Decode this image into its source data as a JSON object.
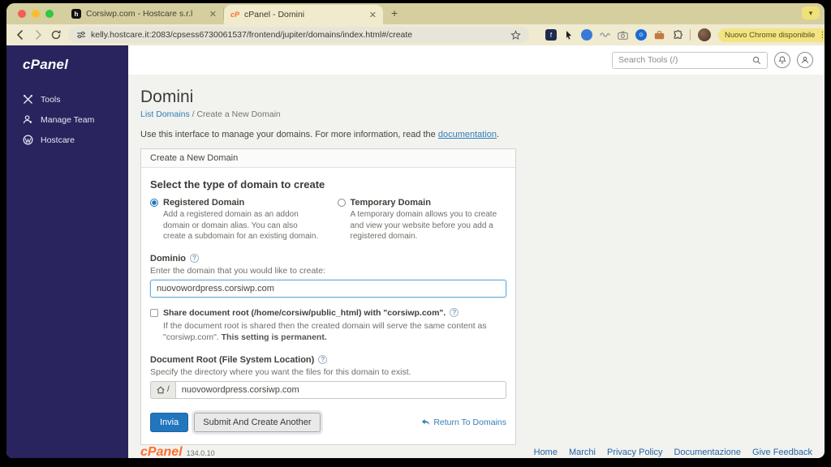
{
  "browser": {
    "tabs": [
      {
        "title": "Corsiwp.com - Hostcare s.r.l",
        "favicon": "h"
      },
      {
        "title": "cPanel - Domini",
        "favicon": "cP"
      }
    ],
    "new_tab": "+",
    "url": "kelly.hostcare.it:2083/cpsess6730061537/frontend/jupiter/domains/index.html#/create",
    "update_button": "Nuovo Chrome disponibile",
    "theme_colors": {
      "tabstrip": "#d5ce9f",
      "toolbar": "#f0ead0",
      "update_pill": "#f2e483"
    }
  },
  "sidebar": {
    "logo": "cPanel",
    "items": [
      {
        "label": "Tools"
      },
      {
        "label": "Manage Team"
      },
      {
        "label": "Hostcare"
      }
    ],
    "bg_color": "#29245e"
  },
  "header": {
    "search_placeholder": "Search Tools (/)"
  },
  "main": {
    "title": "Domini",
    "breadcrumb": {
      "link": "List Domains",
      "separator": "/",
      "current": "Create a New Domain"
    },
    "intro_text": "Use this interface to manage your domains. For more information, read the ",
    "intro_link": "documentation",
    "intro_end": ".",
    "panel": {
      "header": "Create a New Domain",
      "section_title": "Select the type of domain to create",
      "radios": [
        {
          "label": "Registered Domain",
          "desc": "Add a registered domain as an addon domain or domain alias. You can also create a subdomain for an existing domain.",
          "selected": true
        },
        {
          "label": "Temporary Domain",
          "desc": "A temporary domain allows you to create and view your website before you add a registered domain.",
          "selected": false
        }
      ],
      "domain_field": {
        "label": "Dominio",
        "help_text": "Enter the domain that you would like to create:",
        "value": "nuovowordpress.corsiwp.com"
      },
      "share_checkbox": {
        "label": "Share document root (/home/corsiw/public_html) with \"corsiwp.com\".",
        "desc": "If the document root is shared then the created domain will serve the same content as \"corsiwp.com\". ",
        "desc_bold": "This setting is permanent."
      },
      "docroot_field": {
        "label": "Document Root (File System Location)",
        "help_text": "Specify the directory where you want the files for this domain to exist.",
        "prefix": "/",
        "value": "nuovowordpress.corsiwp.com"
      },
      "submit_label": "Invia",
      "submit_another_label": "Submit And Create Another",
      "return_link": "Return To Domains",
      "accent_color": "#2276bd"
    }
  },
  "footer": {
    "logo": "cPanel",
    "version": "134.0.10",
    "links": [
      {
        "label": "Home"
      },
      {
        "label": "Marchi"
      },
      {
        "label": "Privacy Policy"
      },
      {
        "label": "Documentazione"
      },
      {
        "label": "Give Feedback"
      }
    ]
  }
}
